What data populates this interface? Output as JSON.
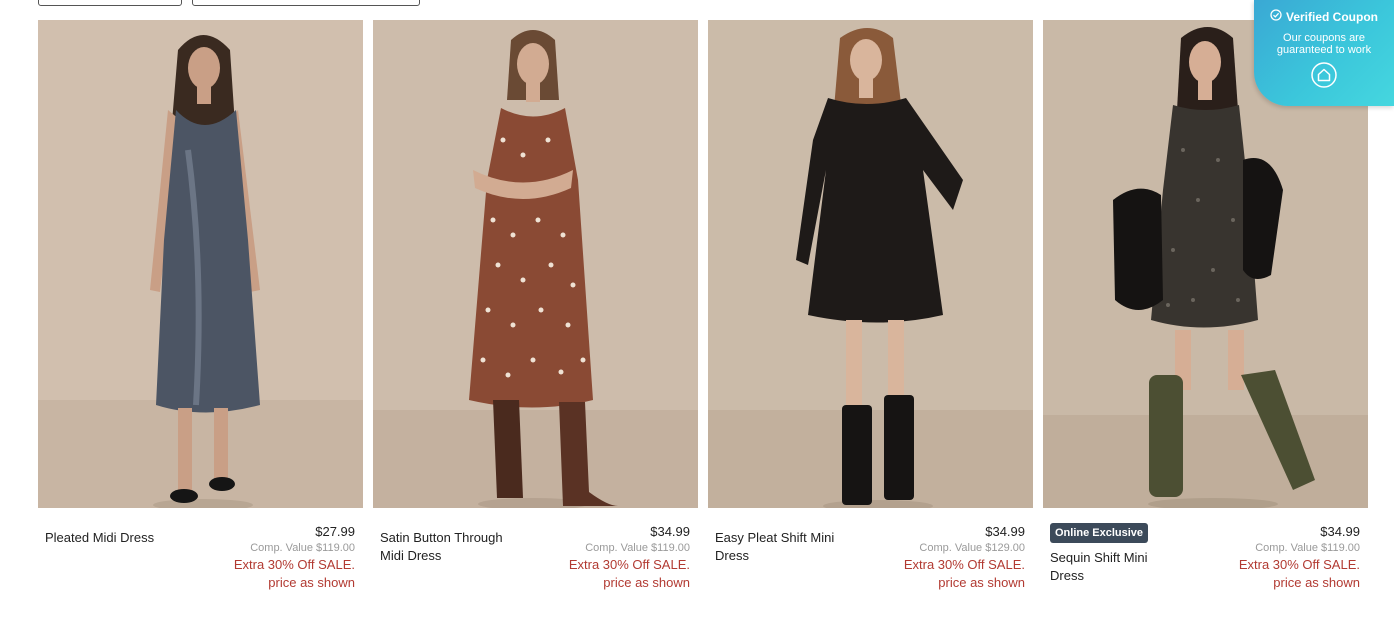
{
  "coupon": {
    "title": "Verified Coupon",
    "body_line1": "Our coupons are",
    "body_line2": "guaranteed to work",
    "icon": "house-icon",
    "check_icon": "check-circle-icon"
  },
  "products": [
    {
      "name_line1": "Pleated Midi Dress",
      "name_line2": "",
      "price": "$27.99",
      "comp": "Comp. Value $119.00",
      "sale_line1": "Extra 30% Off SALE.",
      "sale_line2": "price as shown",
      "badge": ""
    },
    {
      "name_line1": "Satin Button Through",
      "name_line2": "Midi Dress",
      "price": "$34.99",
      "comp": "Comp. Value $119.00",
      "sale_line1": "Extra 30% Off SALE.",
      "sale_line2": "price as shown",
      "badge": ""
    },
    {
      "name_line1": "Easy Pleat Shift Mini",
      "name_line2": "Dress",
      "price": "$34.99",
      "comp": "Comp. Value $129.00",
      "sale_line1": "Extra 30% Off SALE.",
      "sale_line2": "price as shown",
      "badge": ""
    },
    {
      "name_line1": "Sequin Shift Mini",
      "name_line2": "Dress",
      "price": "$34.99",
      "comp": "Comp. Value $119.00",
      "sale_line1": "Extra 30% Off SALE.",
      "sale_line2": "price as shown",
      "badge": "Online Exclusive"
    }
  ],
  "colors": {
    "sale_red": "#b23a32",
    "photo_bg": "#c9b9a8",
    "coupon_teal": "#3bc6db",
    "badge_bg": "#3c4a5a"
  }
}
